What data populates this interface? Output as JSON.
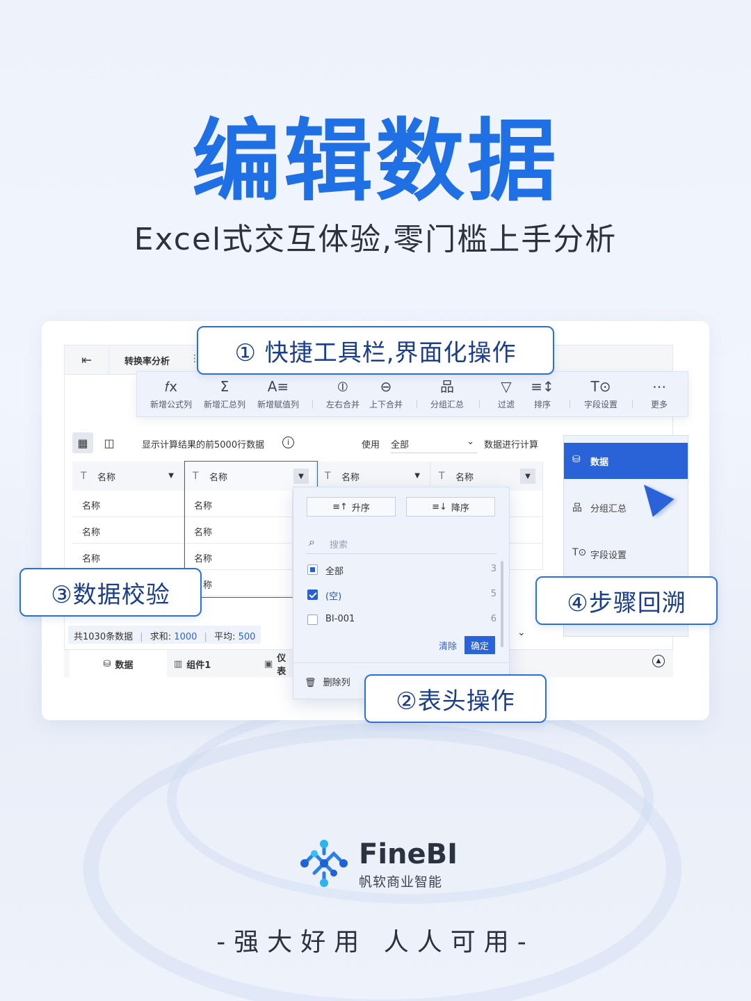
{
  "hero": {
    "title": "编辑数据",
    "subtitle": "Excel式交互体验,零门槛上手分析"
  },
  "app": {
    "tab_title": "转换率分析",
    "tab_more": "⋮",
    "toolbar": [
      {
        "icon": "fx-icon",
        "glyph": "𝑓x",
        "label": "新增公式列"
      },
      {
        "icon": "sigma-icon",
        "glyph": "Σ",
        "label": "新增汇总列"
      },
      {
        "icon": "assign-value-icon",
        "glyph": "A≡",
        "label": "新增赋值列"
      },
      {
        "icon": "left-right-merge-icon",
        "glyph": "⦶",
        "label": "左右合并"
      },
      {
        "icon": "up-down-merge-icon",
        "glyph": "⊖",
        "label": "上下合并"
      },
      {
        "icon": "group-summary-icon",
        "glyph": "品",
        "label": "分组汇总"
      },
      {
        "icon": "filter-icon",
        "glyph": "▽",
        "label": "过滤"
      },
      {
        "icon": "sort-icon",
        "glyph": "≡↕",
        "label": "排序"
      },
      {
        "icon": "field-settings-icon",
        "glyph": "T⊙",
        "label": "字段设置"
      },
      {
        "icon": "more-icon",
        "glyph": "⋯",
        "label": "更多"
      }
    ],
    "view_bar": {
      "note": "显示计算结果的前5000行数据",
      "use_label": "使用",
      "use_value": "全部",
      "calc_label": "数据进行计算"
    },
    "table": {
      "headers": [
        "名称",
        "名称",
        "名称",
        "名称"
      ],
      "col1": [
        "名称",
        "名称",
        "名称"
      ],
      "col2": [
        "名称",
        "名称",
        "名称",
        "名称"
      ]
    },
    "summary": {
      "count": "共1030条数据",
      "sum_label": "求和:",
      "sum_value": "1000",
      "avg_label": "平均:",
      "avg_value": "500"
    },
    "bottom_tabs": [
      "数据",
      "组件1",
      "仪表"
    ],
    "dropdown": {
      "asc": "升序",
      "desc": "降序",
      "search_placeholder": "搜索",
      "options": [
        {
          "label": "全部",
          "count": "3",
          "state": "partial"
        },
        {
          "label": "(空)",
          "count": "5",
          "state": "checked"
        },
        {
          "label": "BI-001",
          "count": "6",
          "state": "unchecked"
        }
      ],
      "clear": "清除",
      "ok": "确定",
      "delete_col": "删除列"
    },
    "side_panel": [
      {
        "label": "数据",
        "active": true
      },
      {
        "label": "分组汇总",
        "active": false
      },
      {
        "label": "字段设置",
        "active": false
      }
    ]
  },
  "callouts": {
    "c1": "① 快捷工具栏,界面化操作",
    "c2": "②表头操作",
    "c3": "③数据校验",
    "c4": "④步骤回溯"
  },
  "brand": {
    "name": "FineBI",
    "sub": "帆软商业智能",
    "slogan": "-强大好用  人人可用-"
  },
  "colors": {
    "accent": "#1f6fe5",
    "primary_button": "#2a62d8"
  }
}
